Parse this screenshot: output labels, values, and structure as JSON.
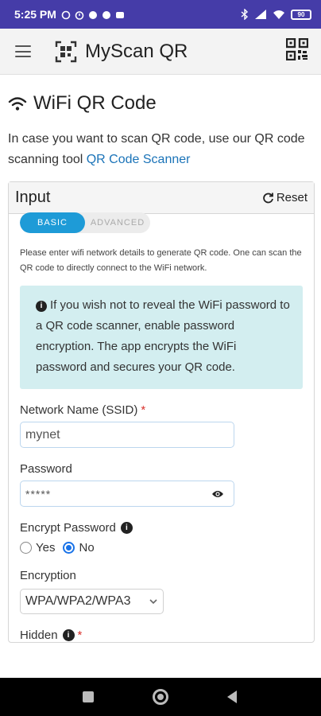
{
  "status_bar": {
    "time": "5:25 PM",
    "battery": "90"
  },
  "app": {
    "title": "MyScan QR"
  },
  "page": {
    "title": "WiFi QR Code",
    "intro_text": "In case you want to scan QR code, use our QR code scanning tool ",
    "intro_link": "QR Code Scanner"
  },
  "input_card": {
    "header": "Input",
    "reset_label": "Reset",
    "tabs": [
      {
        "label": "BASIC",
        "active": true
      },
      {
        "label": "ADVANCED",
        "active": false
      }
    ],
    "help_text": "Please enter wifi network details to generate QR code. One can scan the QR code to directly connect to the WiFi network.",
    "alert_text": "If you wish not to reveal the WiFi password to a QR code scanner, enable password encryption. The app encrypts the WiFi password and secures your QR code."
  },
  "form": {
    "ssid_label": "Network Name (SSID)",
    "ssid_value": "mynet",
    "password_label": "Password",
    "password_value": "*****",
    "encrypt_label": "Encrypt Password",
    "encrypt_options": [
      {
        "label": "Yes",
        "checked": false
      },
      {
        "label": "No",
        "checked": true
      }
    ],
    "encryption_label": "Encryption",
    "encryption_value": "WPA/WPA2/WPA3",
    "hidden_label": "Hidden"
  },
  "colors": {
    "status_bar": "#453ca8",
    "accent": "#1e9bd7",
    "link": "#1a73b8",
    "alert_bg": "#d3eef0",
    "required": "#d9322d"
  }
}
